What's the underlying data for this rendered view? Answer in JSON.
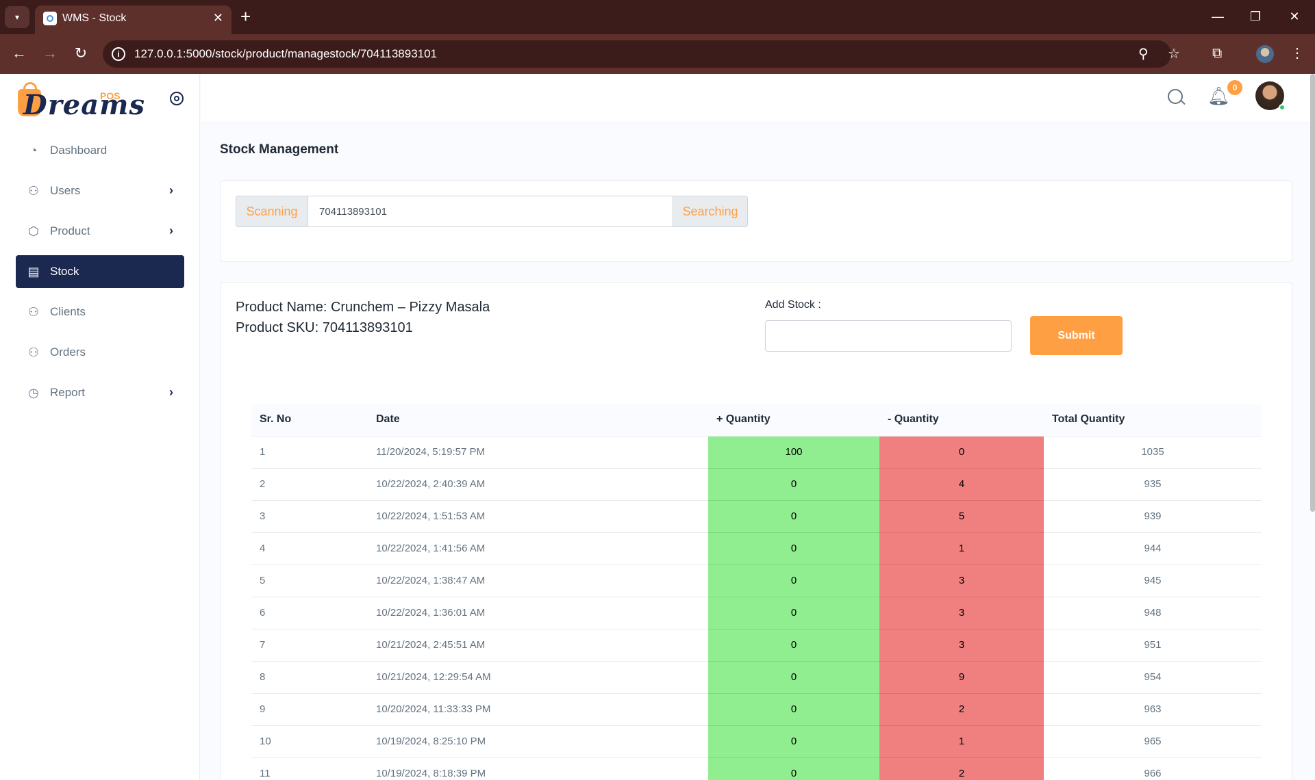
{
  "browser": {
    "tab_title": "WMS - Stock",
    "url": "127.0.0.1:5000/stock/product/managestock/704113893101"
  },
  "sidebar": {
    "logo_text": "Dreams",
    "logo_pos": "POS",
    "items": [
      {
        "label": "Dashboard",
        "icon": "dashboard-icon"
      },
      {
        "label": "Users",
        "icon": "user-icon"
      },
      {
        "label": "Product",
        "icon": "box-icon"
      },
      {
        "label": "Stock",
        "icon": "stock-icon"
      },
      {
        "label": "Clients",
        "icon": "user-icon"
      },
      {
        "label": "Orders",
        "icon": "user-icon"
      },
      {
        "label": "Report",
        "icon": "pie-chart-icon"
      }
    ]
  },
  "header": {
    "notification_count": "0"
  },
  "page": {
    "title": "Stock Management"
  },
  "search": {
    "scan_label": "Scanning",
    "input_value": "704113893101",
    "search_label": "Searching"
  },
  "product": {
    "name_line": "Product Name: Crunchem – Pizzy Masala",
    "sku_line": "Product SKU: 704113893101"
  },
  "add_stock": {
    "label": "Add Stock :",
    "value": "",
    "submit_label": "Submit"
  },
  "colors": {
    "accent": "#ff9f43",
    "sidebar_active": "#1b2850",
    "plus_cell": "#90ee90",
    "minus_cell": "#f08080"
  },
  "table": {
    "headers": [
      "Sr. No",
      "Date",
      "+ Quantity",
      "- Quantity",
      "Total Quantity"
    ],
    "rows": [
      [
        "1",
        "11/20/2024, 5:19:57 PM",
        "100",
        "0",
        "1035"
      ],
      [
        "2",
        "10/22/2024, 2:40:39 AM",
        "0",
        "4",
        "935"
      ],
      [
        "3",
        "10/22/2024, 1:51:53 AM",
        "0",
        "5",
        "939"
      ],
      [
        "4",
        "10/22/2024, 1:41:56 AM",
        "0",
        "1",
        "944"
      ],
      [
        "5",
        "10/22/2024, 1:38:47 AM",
        "0",
        "3",
        "945"
      ],
      [
        "6",
        "10/22/2024, 1:36:01 AM",
        "0",
        "3",
        "948"
      ],
      [
        "7",
        "10/21/2024, 2:45:51 AM",
        "0",
        "3",
        "951"
      ],
      [
        "8",
        "10/21/2024, 12:29:54 AM",
        "0",
        "9",
        "954"
      ],
      [
        "9",
        "10/20/2024, 11:33:33 PM",
        "0",
        "2",
        "963"
      ],
      [
        "10",
        "10/19/2024, 8:25:10 PM",
        "0",
        "1",
        "965"
      ],
      [
        "11",
        "10/19/2024, 8:18:39 PM",
        "0",
        "2",
        "966"
      ]
    ]
  }
}
